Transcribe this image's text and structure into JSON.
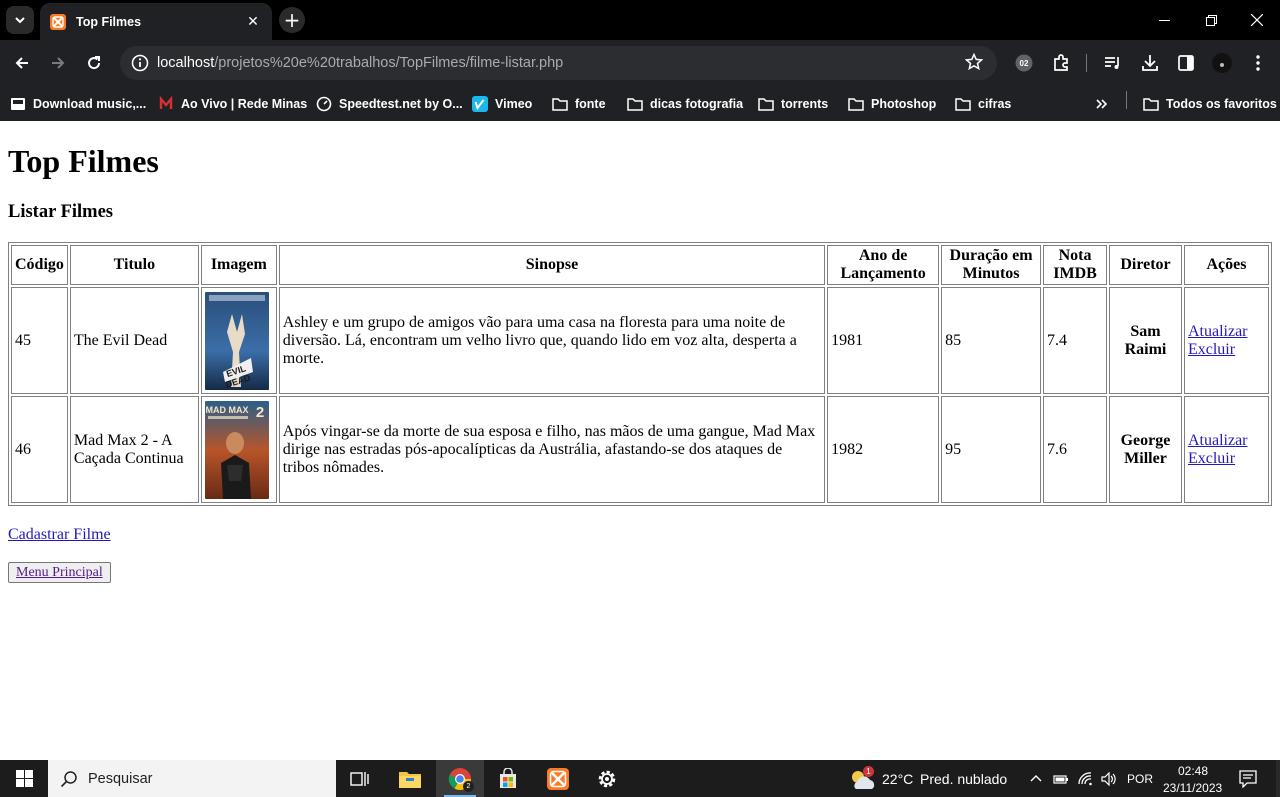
{
  "browser": {
    "tab_title": "Top Filmes",
    "url_host": "localhost",
    "url_path": "/projetos%20e%20trabalhos/TopFilmes/filme-listar.php",
    "profile_badge": "02",
    "bookmarks": [
      {
        "label": "Download music,...",
        "icon": "download-music-icon"
      },
      {
        "label": "Ao Vivo | Rede Minas",
        "icon": "rede-minas-icon"
      },
      {
        "label": "Speedtest.net by O...",
        "icon": "speedtest-icon"
      },
      {
        "label": "Vimeo",
        "icon": "vimeo-icon"
      },
      {
        "label": "fonte",
        "icon": "folder-icon"
      },
      {
        "label": "dicas fotografia",
        "icon": "folder-icon"
      },
      {
        "label": "torrents",
        "icon": "folder-icon"
      },
      {
        "label": "Photoshop",
        "icon": "folder-icon"
      },
      {
        "label": "cifras",
        "icon": "folder-icon"
      }
    ],
    "all_bookmarks_label": "Todos os favoritos"
  },
  "page": {
    "title": "Top Filmes",
    "subtitle": "Listar Filmes",
    "table": {
      "headers": [
        "Código",
        "Titulo",
        "Imagem",
        "Sinopse",
        "Ano de Lançamento",
        "Duração em Minutos",
        "Nota IMDB",
        "Diretor",
        "Ações"
      ],
      "rows": [
        {
          "codigo": "45",
          "titulo": "The Evil Dead",
          "imagem": "evil-dead-poster",
          "sinopse": "Ashley e um grupo de amigos vão para uma casa na floresta para uma noite de diversão. Lá, encontram um velho livro que, quando lido em voz alta, desperta a morte.",
          "ano": "1981",
          "duracao": "85",
          "nota": "7.4",
          "diretor": "Sam Raimi",
          "acao_atualizar": "Atualizar",
          "acao_excluir": "Excluir"
        },
        {
          "codigo": "46",
          "titulo": "Mad Max 2 - A Caçada Continua",
          "imagem": "mad-max-2-poster",
          "sinopse": "Após vingar-se da morte de sua esposa e filho, nas mãos de uma gangue, Mad Max dirige nas estradas pós-apocalípticas da Austrália, afastando-se dos ataques de tribos nômades.",
          "ano": "1982",
          "duracao": "95",
          "nota": "7.6",
          "diretor": "George Miller",
          "acao_atualizar": "Atualizar",
          "acao_excluir": "Excluir"
        }
      ]
    },
    "cadastrar_link": "Cadastrar Filme",
    "menu_button": "Menu Principal"
  },
  "taskbar": {
    "search_placeholder": "Pesquisar",
    "weather_temp": "22°C",
    "weather_text": "Pred. nublado",
    "weather_badge": "1",
    "language": "POR",
    "time": "02:48",
    "date": "23/11/2023",
    "chrome_badge": "2"
  }
}
